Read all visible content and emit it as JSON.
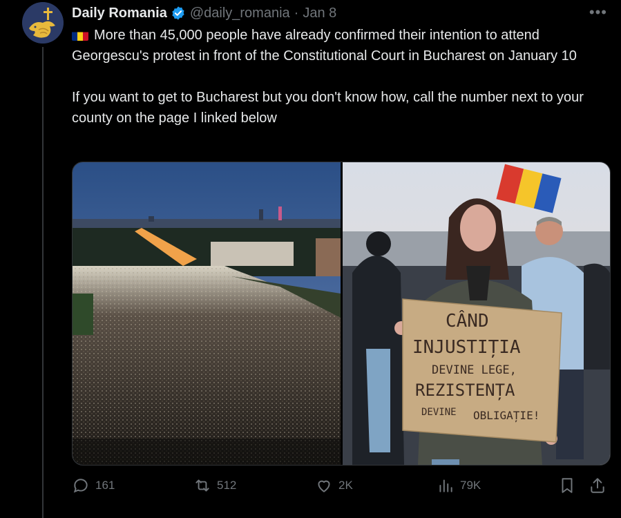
{
  "author": {
    "name": "Daily Romania",
    "handle": "@daily_romania",
    "separator": "·",
    "date": "Jan 8",
    "avatar_icon": "golden-bird-cross-icon"
  },
  "tweet": {
    "paragraph1": "More than 45,000 people have already confirmed their intention to attend Georgescu's protest in front of the Constitutional Court in Bucharest on January 10",
    "paragraph2": "If you want to get to Bucharest but you don't know how, call the number next to your county on the page I linked below",
    "flag_icon": "romania-flag-icon"
  },
  "media": {
    "sign": {
      "line1": "CÂND",
      "line2": "INJUSTIȚIA",
      "line3": "DEVINE LEGE,",
      "line4": "REZISTENȚA",
      "line5a": "DEVINE",
      "line5b": "OBLIGAȚIE!"
    }
  },
  "actions": {
    "replies": "161",
    "reposts": "512",
    "likes": "2K",
    "views": "79K"
  },
  "colors": {
    "background": "#000000",
    "text": "#e7e9ea",
    "muted": "#71767b",
    "verified": "#1d9bf0"
  }
}
